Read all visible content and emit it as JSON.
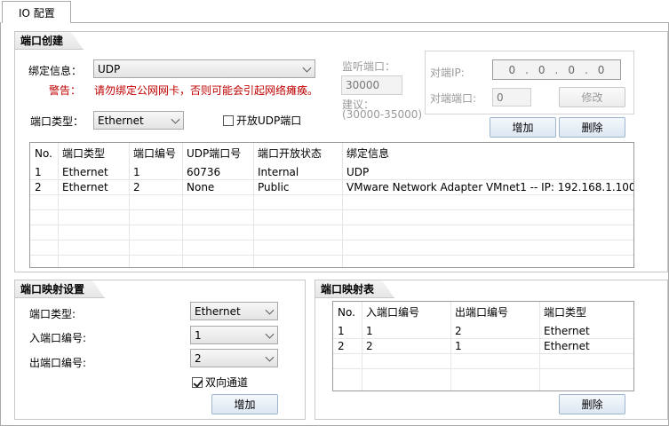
{
  "tab": {
    "label": "IO 配置"
  },
  "port_create": {
    "title": "端口创建",
    "bind_label": "绑定信息：",
    "bind_value": "UDP",
    "warning_label": "警告：",
    "warning_text": "请勿绑定公网网卡，否则可能会引起网络瘫痪。",
    "port_type_label": "端口类型：",
    "port_type_value": "Ethernet",
    "open_udp_label": "开放UDP端口",
    "open_udp_checked": false,
    "listen_port_label": "监听端口：",
    "listen_port_value": "30000",
    "suggest_label": "建议：",
    "suggest_range": "(30000-35000)",
    "peer_ip_label": "对端IP:",
    "peer_ip_value": [
      "0",
      "0",
      "0",
      "0"
    ],
    "peer_port_label": "对端端口:",
    "peer_port_value": "0",
    "modify_button": "修改",
    "add_button": "增加",
    "delete_button": "删除",
    "table": {
      "headers": [
        "No.",
        "端口类型",
        "端口编号",
        "UDP端口号",
        "端口开放状态",
        "绑定信息"
      ],
      "rows": [
        [
          "1",
          "Ethernet",
          "1",
          "60736",
          "Internal",
          "UDP"
        ],
        [
          "2",
          "Ethernet",
          "2",
          "None",
          "Public",
          "VMware Network Adapter VMnet1 -- IP: 192.168.1.100"
        ]
      ]
    }
  },
  "mapping_settings": {
    "title": "端口映射设置",
    "port_type_label": "端口类型:",
    "port_type_value": "Ethernet",
    "in_port_label": "入端口编号:",
    "in_port_value": "1",
    "out_port_label": "出端口编号:",
    "out_port_value": "2",
    "bidirectional_label": "双向通道",
    "bidirectional_checked": true,
    "add_button": "增加"
  },
  "mapping_table": {
    "title": "端口映射表",
    "headers": [
      "No.",
      "入端口编号",
      "出端口编号",
      "端口类型"
    ],
    "rows": [
      [
        "1",
        "1",
        "2",
        "Ethernet"
      ],
      [
        "2",
        "2",
        "1",
        "Ethernet"
      ]
    ],
    "delete_button": "删除"
  }
}
